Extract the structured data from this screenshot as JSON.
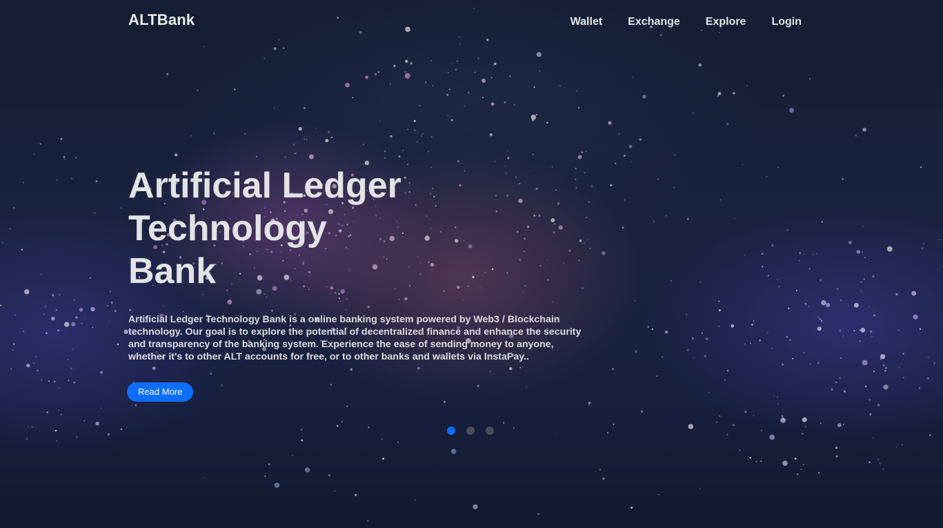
{
  "brand": "ALTBank",
  "nav": {
    "wallet": "Wallet",
    "exchange": "Exchange",
    "explore": "Explore",
    "login": "Login"
  },
  "hero": {
    "title_lines": [
      "Artificial Ledger",
      "Technology",
      "Bank"
    ],
    "description": "Artificial Ledger Technology Bank is a online banking system powered by Web3 / Blockchain technology. Our goal is to explore the potential of decentralized finance and enhance the security and transparency of the banking system. Experience the ease of sending money to anyone, whether it's to other ALT accounts for free, or to other banks and wallets via InstaPay..",
    "button_label": "Read More"
  },
  "carousel": {
    "slide_count": 3,
    "active_index": 0
  },
  "colors": {
    "accent": "#0d6efd",
    "inactive_dot": "#4a4f5a"
  }
}
